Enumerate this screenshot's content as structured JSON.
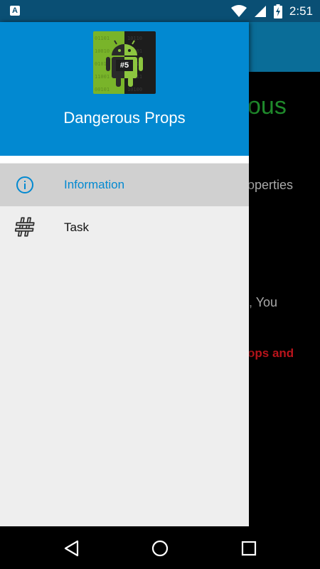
{
  "status_bar": {
    "time": "2:51",
    "left_icon_letter": "A",
    "icons": [
      "wifi-icon",
      "cellular-signal-icon",
      "battery-charging-icon"
    ]
  },
  "background": {
    "title_fragment": "ous",
    "line1_fragment": "operties",
    "line2_fragment": "e, You",
    "line3_fragment": "ops and",
    "title_color": "#1f8a2b",
    "warning_color": "#b8141b"
  },
  "drawer": {
    "app_title": "Dangerous Props",
    "logo_badge": "#5",
    "header_color": "#0289d1",
    "items": [
      {
        "label": "Information",
        "icon": "info-icon",
        "active": true
      },
      {
        "label": "Task",
        "icon": "hash-icon",
        "active": false
      }
    ]
  },
  "nav_bar": {
    "buttons": [
      "back-icon",
      "home-icon",
      "recents-icon"
    ]
  }
}
